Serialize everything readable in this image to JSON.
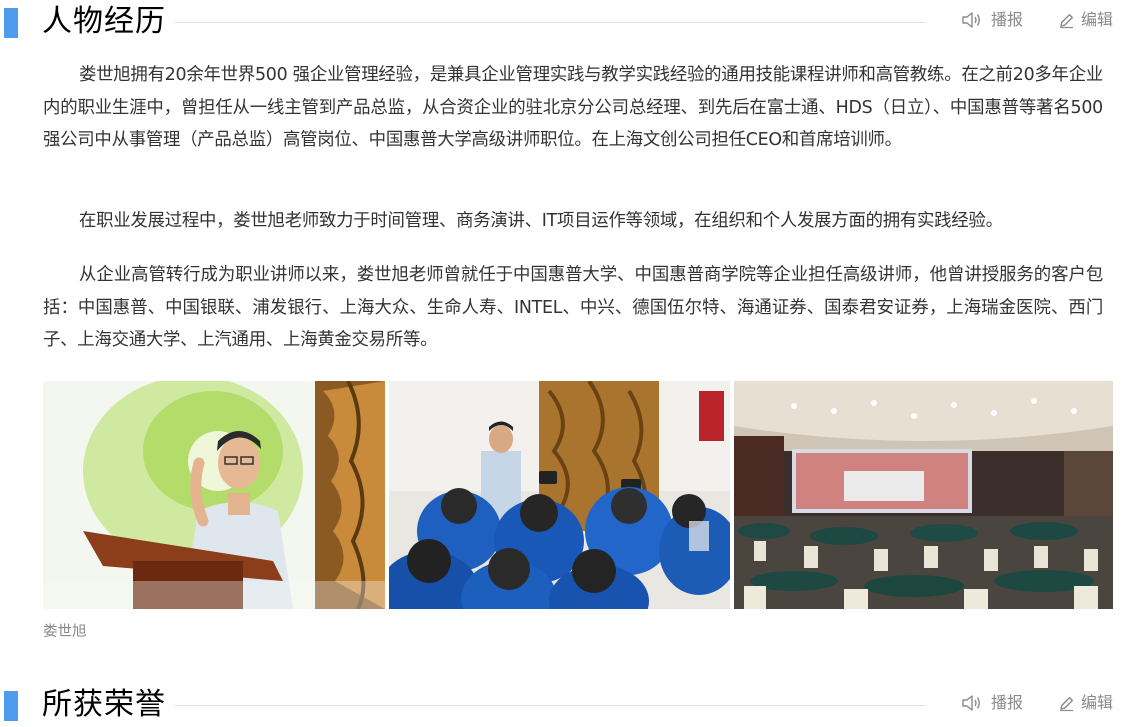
{
  "sections": [
    {
      "title": "人物经历",
      "play_label": "播报",
      "edit_label": "编辑"
    },
    {
      "title": "所获荣誉",
      "play_label": "播报",
      "edit_label": "编辑"
    }
  ],
  "paragraphs": [
    "娄世旭拥有20余年世界500 强企业管理经验，是兼具企业管理实践与教学实践经验的通用技能课程讲师和高管教练。在之前20多年企业内的职业生涯中，曾担任从一线主管到产品总监，从合资企业的驻北京分公司总经理、到先后在富士通、HDS（日立）、中国惠普等著名500强公司中从事管理（产品总监）高管岗位、中国惠普大学高级讲师职位。在上海文创公司担任CEO和首席培训师。",
    "在职业发展过程中，娄世旭老师致力于时间管理、商务演讲、IT项目运作等领域，在组织和个人发展方面的拥有实践经验。",
    "从企业高管转行成为职业讲师以来，娄世旭老师曾就任于中国惠普大学、中国惠普商学院等企业担任高级讲师，他曾讲授服务的客户包括：中国惠普、中国银联、浦发银行、上海大众、生命人寿、INTEL、中兴、德国伍尔特、海通证券、国泰君安证券，上海瑞金医院、西门子、上海交通大学、上汽通用、上海黄金交易所等。"
  ],
  "album": {
    "caption": "娄世旭"
  },
  "icons": {
    "play": "speaker-icon",
    "edit": "pencil-icon"
  },
  "colors": {
    "accent": "#4f9cee",
    "muted": "#8a8a8a",
    "text": "#333333",
    "title": "#000000"
  }
}
